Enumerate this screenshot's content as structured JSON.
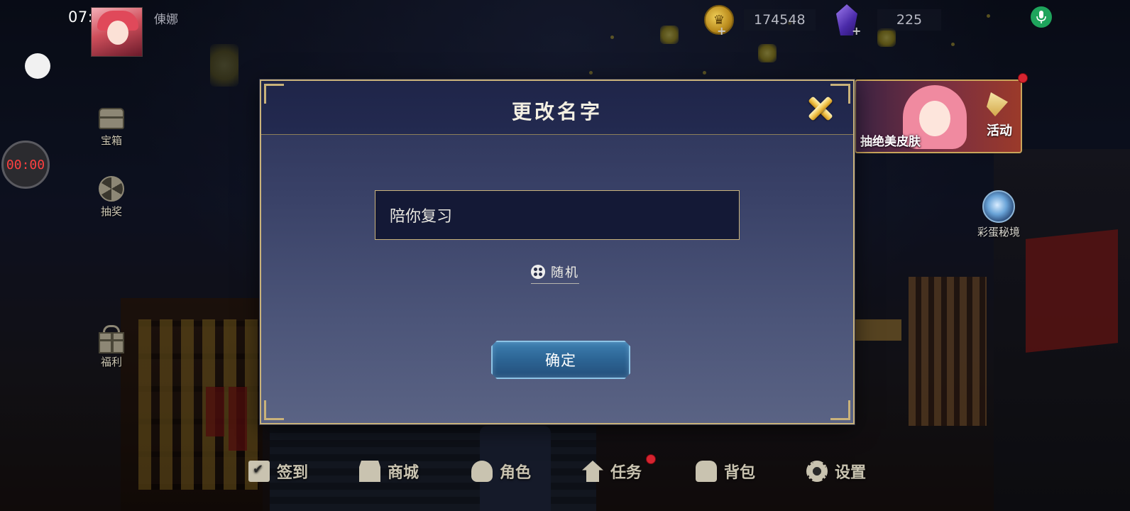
{
  "status": {
    "time": "07:35"
  },
  "player": {
    "name": "倲娜"
  },
  "recorder": {
    "timer": "00:00"
  },
  "currencies": [
    {
      "icon": "gold-coin-icon",
      "value": "174548"
    },
    {
      "icon": "purple-gem-icon",
      "value": "225"
    }
  ],
  "left_menu": [
    {
      "icon": "chest-icon",
      "label": "宝箱"
    },
    {
      "icon": "lottery-icon",
      "label": "抽奖"
    },
    {
      "icon": "gift-icon",
      "label": "福利"
    }
  ],
  "event": {
    "caption": "抽绝美皮肤",
    "activity_label": "活动"
  },
  "secret_realm": {
    "label": "彩蛋秘境"
  },
  "bottom_nav": [
    {
      "icon": "checkin-icon",
      "label": "签到"
    },
    {
      "icon": "shop-icon",
      "label": "商城"
    },
    {
      "icon": "character-icon",
      "label": "角色"
    },
    {
      "icon": "task-icon",
      "label": "任务"
    },
    {
      "icon": "backpack-icon",
      "label": "背包"
    },
    {
      "icon": "settings-icon",
      "label": "设置"
    }
  ],
  "modal": {
    "title": "更改名字",
    "input_value": "陪你复习",
    "random_label": "随机",
    "confirm_label": "确定"
  },
  "colors": {
    "modal_border": "#c9b27a",
    "confirm_button": "#2c6494",
    "notification_dot": "#d62430",
    "mic_green": "#1ea45c"
  }
}
